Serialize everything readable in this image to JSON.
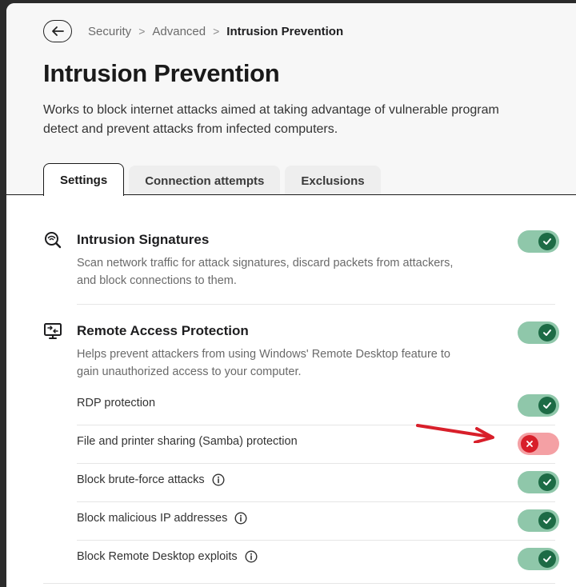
{
  "breadcrumb": {
    "items": [
      "Security",
      "Advanced"
    ],
    "separator": ">",
    "current": "Intrusion Prevention"
  },
  "page": {
    "title": "Intrusion Prevention",
    "description_line1": "Works to block internet attacks aimed at taking advantage of vulnerable program",
    "description_line2": "detect and prevent attacks from infected computers."
  },
  "tabs": [
    {
      "label": "Settings",
      "active": true
    },
    {
      "label": "Connection attempts",
      "active": false
    },
    {
      "label": "Exclusions",
      "active": false
    }
  ],
  "sections": {
    "signatures": {
      "icon": "signature-scan-icon",
      "title": "Intrusion Signatures",
      "desc_line1": "Scan network traffic for attack signatures, discard packets from attackers,",
      "desc_line2": "and block connections to them.",
      "enabled": true
    },
    "remote": {
      "icon": "remote-desktop-icon",
      "title": "Remote Access Protection",
      "desc_line1": "Helps prevent attackers from using Windows' Remote Desktop feature to",
      "desc_line2": "gain unauthorized access to your computer.",
      "enabled": true,
      "items": [
        {
          "label": "RDP protection",
          "enabled": true,
          "info": false
        },
        {
          "label": "File and printer sharing (Samba) protection",
          "enabled": false,
          "info": false
        },
        {
          "label": "Block brute-force attacks",
          "enabled": true,
          "info": true
        },
        {
          "label": "Block malicious IP addresses",
          "enabled": true,
          "info": true
        },
        {
          "label": "Block Remote Desktop exploits",
          "enabled": true,
          "info": true
        }
      ]
    }
  },
  "colors": {
    "toggle_on_track": "#8fc7aa",
    "toggle_on_knob": "#1d6b45",
    "toggle_off_track": "#f4a0a4",
    "toggle_off_knob": "#d81f2a",
    "annotation_arrow": "#d81f2a"
  }
}
